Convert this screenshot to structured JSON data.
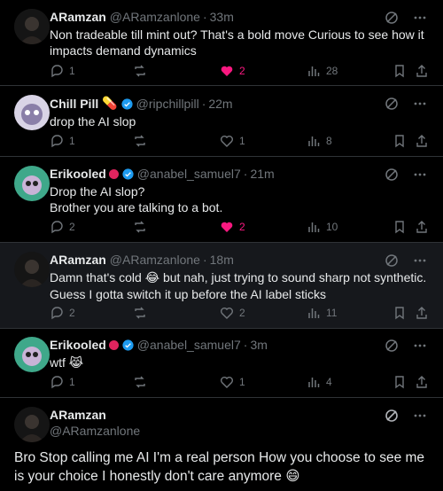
{
  "replies": [
    {
      "name": "ARamzan",
      "handle": "@ARamzanlone",
      "time": "33m",
      "text": "Non tradeable till mint out? That's a bold move Curious to see how it impacts demand dynamics",
      "replies": "1",
      "reposts": "",
      "likes": "2",
      "liked": true,
      "views": "28"
    },
    {
      "name": "Chill Pill",
      "name_emoji": "💊",
      "handle": "@ripchillpill",
      "time": "22m",
      "text": "drop the AI slop",
      "replies": "1",
      "reposts": "",
      "likes": "1",
      "liked": false,
      "views": "8"
    },
    {
      "name": "Erikooled",
      "handle": "@anabel_samuel7",
      "time": "21m",
      "text_line1": "Drop the AI slop?",
      "text_line2": "Brother you are talking to a bot.",
      "replies": "2",
      "reposts": "",
      "likes": "2",
      "liked": true,
      "views": "10"
    },
    {
      "name": "ARamzan",
      "handle": "@ARamzanlone",
      "time": "18m",
      "text_a": "Damn that's cold ",
      "text_emoji": "😂",
      "text_b": " but nah, just trying to sound sharp not synthetic. Guess I gotta switch it up before the AI label sticks",
      "replies": "2",
      "reposts": "",
      "likes": "2",
      "liked": false,
      "views": "11"
    },
    {
      "name": "Erikooled",
      "handle": "@anabel_samuel7",
      "time": "3m",
      "text": "wtf ",
      "text_emoji": "😹",
      "replies": "1",
      "reposts": "",
      "likes": "1",
      "liked": false,
      "views": "4"
    }
  ],
  "main": {
    "name": "ARamzan",
    "handle": "@ARamzanlone",
    "text": "Bro Stop calling me AI I'm a real person How you choose to see me is your choice I honestly don't care anymore ",
    "text_emoji": "😄"
  },
  "colors": {
    "like": "#f91880",
    "muted": "#71767b",
    "verified": "#1d9bf0",
    "badge": "#e0245e"
  }
}
